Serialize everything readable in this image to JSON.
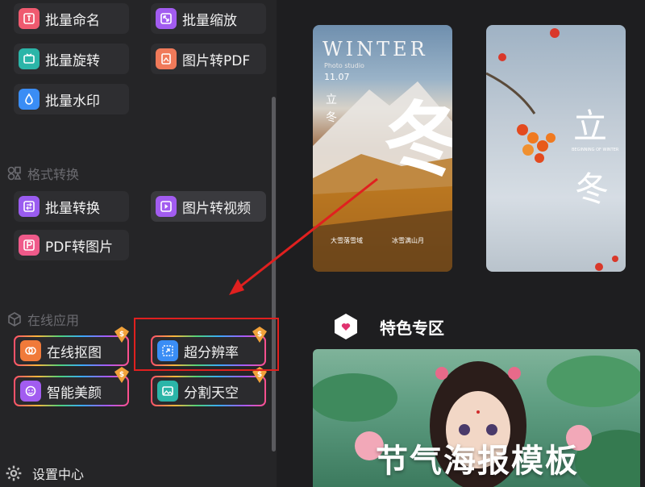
{
  "tools_batch": [
    {
      "label": "批量命名",
      "icon": "rename-icon",
      "color": "#ef5a6f"
    },
    {
      "label": "批量缩放",
      "icon": "resize-icon",
      "color": "#a25cf0"
    },
    {
      "label": "批量旋转",
      "icon": "rotate-icon",
      "color": "#2bb5a8"
    },
    {
      "label": "图片转PDF",
      "icon": "pdf-icon",
      "color": "#f07a5a"
    },
    {
      "label": "批量水印",
      "icon": "watermark-icon",
      "color": "#3a8df5"
    }
  ],
  "section_format": {
    "label": "格式转换"
  },
  "tools_format": [
    {
      "label": "批量转换",
      "icon": "convert-icon",
      "color": "#9a5cf0"
    },
    {
      "label": "图片转视频",
      "icon": "video-icon",
      "color": "#a25cf0"
    },
    {
      "label": "PDF转图片",
      "icon": "pdf-image-icon",
      "color": "#ef5a8a"
    }
  ],
  "section_online": {
    "label": "在线应用"
  },
  "tools_online": [
    {
      "label": "在线抠图",
      "icon": "cutout-icon",
      "color": "#f07a3a",
      "premium": true
    },
    {
      "label": "超分辨率",
      "icon": "superres-icon",
      "color": "#3a8df5",
      "premium": true
    },
    {
      "label": "智能美颜",
      "icon": "beauty-icon",
      "color": "#a25cf0",
      "premium": true
    },
    {
      "label": "分割天空",
      "icon": "sky-icon",
      "color": "#2bb5a8",
      "premium": true
    }
  ],
  "premium_badge": "$",
  "settings": {
    "label": "设置中心"
  },
  "poster1": {
    "title": "WINTER",
    "sub": "Photo studio",
    "date": "11.07",
    "v1": "立",
    "v2": "冬",
    "big": "冬",
    "small1": "大雪落雪域",
    "small2": "冰雪满山月"
  },
  "poster2": {
    "big1": "立",
    "big2": "冬",
    "small": "BEGINNING OF WINTER"
  },
  "featured": {
    "title": "特色专区",
    "banner_text": "节气海报模板"
  }
}
